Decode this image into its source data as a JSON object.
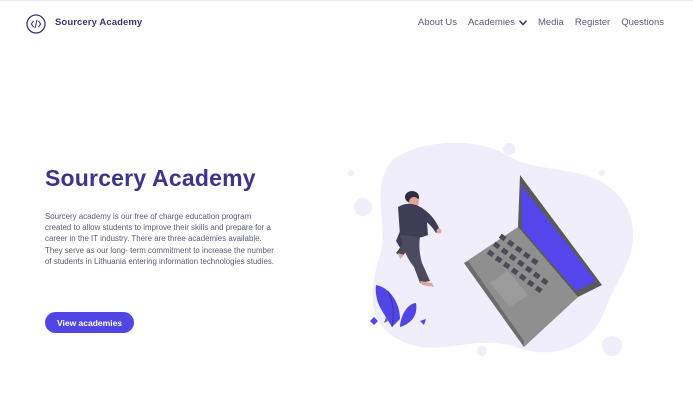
{
  "header": {
    "brand": "Sourcery Academy",
    "logo_icon": "code-slash-icon",
    "nav": [
      {
        "label": "About Us"
      },
      {
        "label": "Academies",
        "icon": "chevron-down-icon"
      },
      {
        "label": "Media"
      },
      {
        "label": "Register"
      },
      {
        "label": "Questions"
      }
    ]
  },
  "hero": {
    "title": "Sourcery Academy",
    "description": "Sourcery academy is our free of charge education program created to allow students to improve their skills and prepare for a career in the IT industry. There are three academies available. They serve as our long- term commitment to increase the number of students in Lithuania entering information technologies studies.",
    "cta_label": "View academies"
  },
  "colors": {
    "accent": "#5145e6",
    "title": "#3d3587",
    "blob": "#efeefa"
  }
}
